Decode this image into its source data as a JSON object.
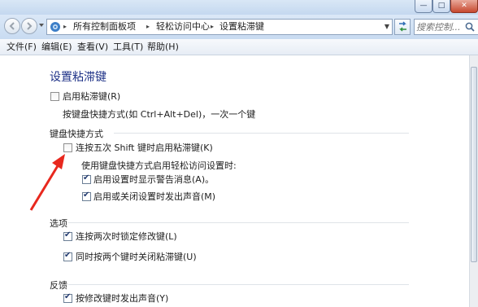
{
  "window": {
    "controls": {
      "minimize": "—",
      "maximize": "□",
      "close": "✕"
    }
  },
  "address_bar": {
    "icon": "control-panel-icon",
    "crumbs": [
      "所有控制面板项",
      "轻松访问中心",
      "设置粘滞键"
    ],
    "separator": "▸"
  },
  "search": {
    "placeholder": "搜索控制..."
  },
  "menu": [
    "文件(F)",
    "编辑(E)",
    "查看(V)",
    "工具(T)",
    "帮助(H)"
  ],
  "page": {
    "title": "设置粘滞键",
    "enable_sticky": {
      "label": "启用粘滞键(R)",
      "checked": false
    },
    "enable_desc": "按键盘快捷方式(如 Ctrl+Alt+Del)，一次一个键",
    "shortcut_section": "键盘快捷方式",
    "shift5": {
      "label": "连按五次 Shift 键时启用粘滞键(K)",
      "checked": false
    },
    "shortcut_sub": "使用键盘快捷方式启用轻松访问设置时:",
    "warn": {
      "label": "启用设置时显示警告消息(A)。",
      "checked": true
    },
    "sound": {
      "label": "启用或关闭设置时发出声音(M)",
      "checked": true
    },
    "options_section": "选项",
    "lock": {
      "label": "连按两次时锁定修改键(L)",
      "checked": true
    },
    "close2": {
      "label": "同时按两个键时关闭粘滞键(U)",
      "checked": true
    },
    "feedback_section": "反馈",
    "beep": {
      "label": "按修改键时发出声音(Y)",
      "checked": true
    }
  },
  "colors": {
    "title": "#1e3287",
    "arrow": "#e8281e",
    "chrome": "#c8dbf1"
  }
}
